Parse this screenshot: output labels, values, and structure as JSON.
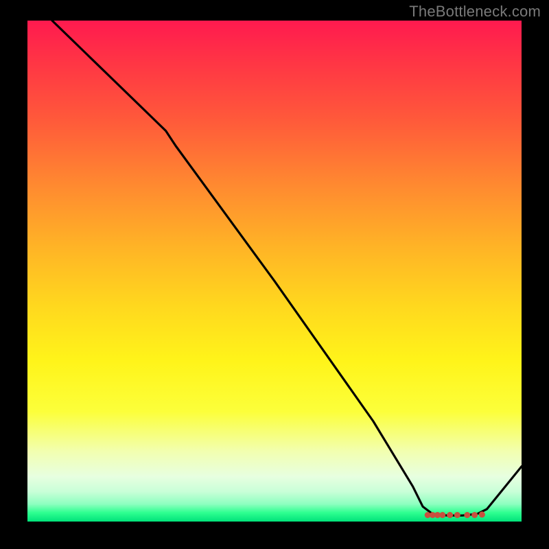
{
  "watermark": "TheBottleneck.com",
  "chart_data": {
    "type": "line",
    "title": "",
    "xlabel": "",
    "ylabel": "",
    "xlim": [
      0,
      100
    ],
    "ylim": [
      0,
      100
    ],
    "grid": false,
    "legend": false,
    "background": "vertical-gradient red→yellow→green",
    "series": [
      {
        "name": "curve",
        "color": "#000000",
        "points": [
          {
            "x": 5,
            "y": 100
          },
          {
            "x": 28,
            "y": 78
          },
          {
            "x": 30,
            "y": 75
          },
          {
            "x": 50,
            "y": 48
          },
          {
            "x": 70,
            "y": 20
          },
          {
            "x": 78,
            "y": 7
          },
          {
            "x": 80,
            "y": 3
          },
          {
            "x": 82,
            "y": 1.5
          },
          {
            "x": 85,
            "y": 1.2
          },
          {
            "x": 88,
            "y": 1.2
          },
          {
            "x": 91,
            "y": 1.5
          },
          {
            "x": 93,
            "y": 2.5
          },
          {
            "x": 100,
            "y": 11
          }
        ]
      },
      {
        "name": "bottom-markers",
        "color": "#d44",
        "type": "scatter",
        "points": [
          {
            "x": 81,
            "y": 1.3
          },
          {
            "x": 82,
            "y": 1.3
          },
          {
            "x": 83,
            "y": 1.3
          },
          {
            "x": 84,
            "y": 1.3
          },
          {
            "x": 85.5,
            "y": 1.3
          },
          {
            "x": 87,
            "y": 1.3
          },
          {
            "x": 89,
            "y": 1.3
          },
          {
            "x": 90.5,
            "y": 1.3
          },
          {
            "x": 92,
            "y": 1.4
          }
        ]
      }
    ]
  }
}
